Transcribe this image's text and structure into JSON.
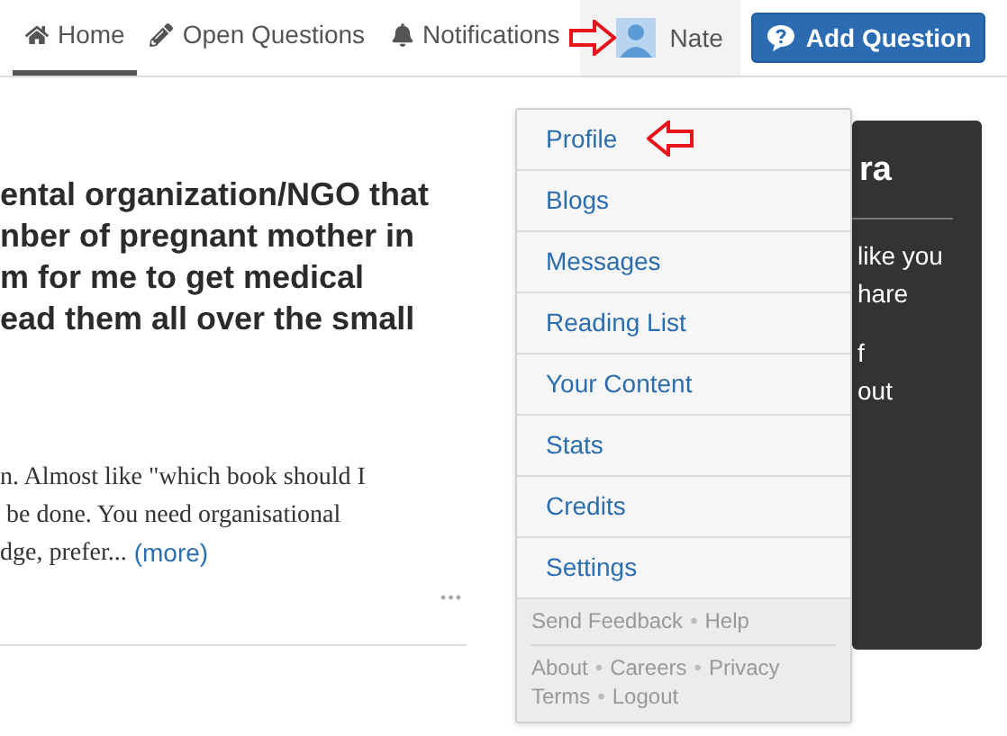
{
  "nav": {
    "tabs": [
      {
        "label": "Home",
        "selected": true
      },
      {
        "label": "Open Questions",
        "selected": false
      },
      {
        "label": "Notifications",
        "selected": false
      }
    ],
    "user": {
      "name": "Nate",
      "expanded": true
    },
    "add_button": "Add Question"
  },
  "question": {
    "title_lines": [
      "ental organization/NGO that",
      "nber of pregnant mother in",
      "m for me to get medical",
      "ead them all over the small"
    ],
    "answer_lines": [
      "n. Almost like \"which book should I",
      " be done. You need organisational",
      "dge, prefer..."
    ],
    "more_link": "(more)",
    "menu": "•••"
  },
  "side_panel": {
    "heading": "ra",
    "lines": [
      "like you",
      "hare",
      "f",
      "out"
    ]
  },
  "user_menu": {
    "items": [
      {
        "label": "Profile"
      },
      {
        "label": "Blogs"
      },
      {
        "label": "Messages"
      },
      {
        "label": "Reading List"
      },
      {
        "label": "Your Content"
      },
      {
        "label": "Stats"
      },
      {
        "label": "Credits"
      },
      {
        "label": "Settings"
      }
    ],
    "footer_rows": [
      {
        "items": [
          {
            "kind": "link",
            "text": "Send Feedback"
          },
          {
            "kind": "sep",
            "text": "•"
          },
          {
            "kind": "link",
            "text": "Help"
          }
        ]
      },
      {
        "items": [
          {
            "kind": "link",
            "text": "About"
          },
          {
            "kind": "sep",
            "text": "•"
          },
          {
            "kind": "link",
            "text": "Careers"
          },
          {
            "kind": "sep",
            "text": "•"
          },
          {
            "kind": "link",
            "text": "Privacy"
          }
        ]
      },
      {
        "items": [
          {
            "kind": "link",
            "text": "Terms"
          },
          {
            "kind": "sep",
            "text": "•"
          },
          {
            "kind": "link",
            "text": "Logout"
          }
        ]
      }
    ]
  }
}
